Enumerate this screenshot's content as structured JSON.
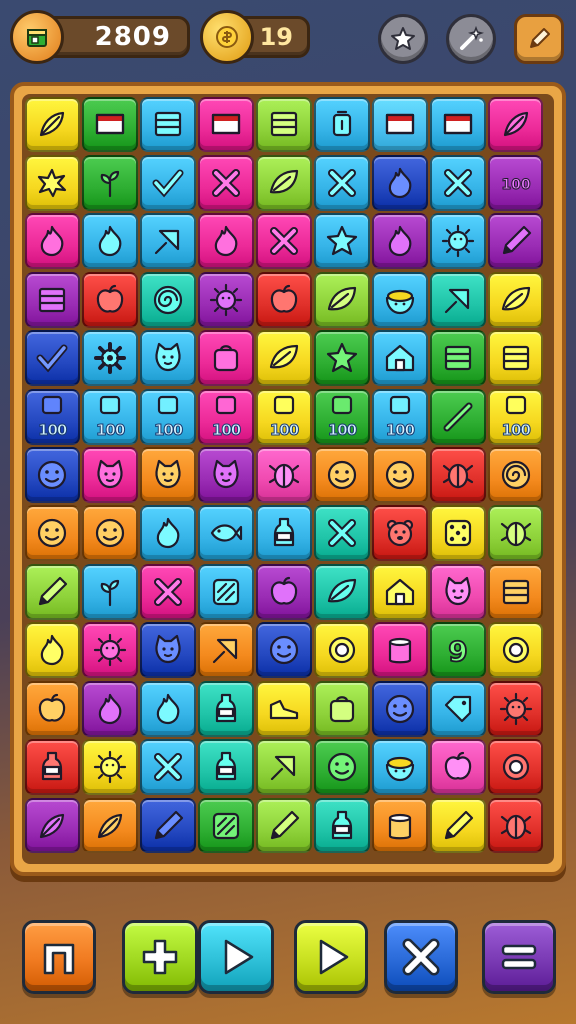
{
  "hud": {
    "coins": "2809",
    "gems": "19",
    "coin_icon": "shop-box-icon",
    "gem_icon": "gold-coin-icon"
  },
  "top_buttons": [
    {
      "name": "achievements-button",
      "icon": "star-badge-icon"
    },
    {
      "name": "boosters-button",
      "icon": "magic-wand-icon"
    },
    {
      "name": "edit-button",
      "icon": "pencil-icon"
    }
  ],
  "board": {
    "rows": 12,
    "cols": 9,
    "count_label": "100",
    "colors": {
      "yellow": "#f6d820",
      "green": "#2eae32",
      "cyan": "#36b4e8",
      "magenta": "#ec2a98",
      "lime": "#8ed23a",
      "orange": "#f48a1e",
      "red": "#e0302a",
      "purple": "#9a2cb4",
      "blue": "#2448c0",
      "teal": "#20c4a8",
      "pink": "#f04ab0",
      "sky": "#4ac0f0"
    },
    "tiles": [
      [
        "yellow:feather",
        "green:flag",
        "cyan:crate",
        "magenta:flag",
        "lime:crate",
        "cyan:lantern",
        "sky:flag",
        "cyan:flag",
        "magenta:feather"
      ],
      [
        "yellow:splat",
        "green:sprout",
        "cyan:check",
        "magenta:cross",
        "lime:leaf",
        "cyan:cross",
        "blue:flame",
        "cyan:cross",
        "purple:text100"
      ],
      [
        "magenta:flame",
        "cyan:flame",
        "cyan:arrow",
        "magenta:flame",
        "magenta:cross",
        "cyan:star",
        "purple:flame",
        "cyan:sun",
        "purple:pencil"
      ],
      [
        "purple:crate",
        "red:apple",
        "teal:spiral",
        "purple:sun",
        "red:apple",
        "lime:leaf",
        "cyan:bowl",
        "teal:arrow",
        "yellow:leaf"
      ],
      [
        "blue:check",
        "cyan:gear",
        "cyan:cat",
        "magenta:bag",
        "yellow:leaf",
        "green:star",
        "cyan:house",
        "green:crate",
        "yellow:crate"
      ],
      [
        "blue:count",
        "cyan:count",
        "cyan:count",
        "magenta:count",
        "yellow:count",
        "green:count",
        "cyan:count",
        "green:stick",
        "yellow:count"
      ],
      [
        "blue:face",
        "magenta:cat",
        "orange:cat",
        "purple:cat",
        "pink:bug",
        "orange:face",
        "orange:face",
        "red:bug",
        "orange:spiral"
      ],
      [
        "orange:face",
        "orange:face",
        "cyan:flame",
        "cyan:fish",
        "cyan:bottle",
        "teal:cross",
        "red:bear",
        "yellow:dice",
        "lime:bug"
      ],
      [
        "lime:pencil",
        "cyan:sprout",
        "magenta:cross",
        "cyan:hatch",
        "purple:apple",
        "teal:leaf",
        "yellow:house",
        "pink:cat",
        "orange:crate"
      ],
      [
        "yellow:flame",
        "magenta:sun",
        "blue:cat",
        "orange:arrow",
        "blue:face",
        "yellow:ring",
        "magenta:cup",
        "green:nine",
        "yellow:ring"
      ],
      [
        "orange:apple",
        "purple:flame",
        "cyan:flame",
        "teal:bottle",
        "yellow:shoe",
        "lime:bag",
        "blue:face",
        "cyan:tag",
        "red:sun"
      ],
      [
        "red:bottle",
        "yellow:sun",
        "cyan:cross",
        "teal:bottle",
        "lime:arrow",
        "green:face",
        "cyan:bowl",
        "pink:apple",
        "red:ring"
      ]
    ],
    "last_row": [
      "purple:feather",
      "orange:feather",
      "blue:pencil",
      "green:hatch",
      "lime:pencil",
      "teal:bottle",
      "orange:cup",
      "yellow:pencil",
      "red:bug"
    ]
  },
  "bottom_buttons": [
    {
      "name": "home-button",
      "icon": "door-icon",
      "color": "#f07a20"
    },
    {
      "name": "add-button",
      "icon": "plus-icon",
      "color": "#a0d820"
    },
    {
      "name": "play-button",
      "icon": "play-icon",
      "color": "#2ec0d8"
    },
    {
      "name": "next-button",
      "icon": "play-icon",
      "color": "#c8e020"
    },
    {
      "name": "close-button",
      "icon": "close-icon",
      "color": "#2a6ad8"
    },
    {
      "name": "menu-button",
      "icon": "menu-icon",
      "color": "#7a3ab4"
    }
  ]
}
